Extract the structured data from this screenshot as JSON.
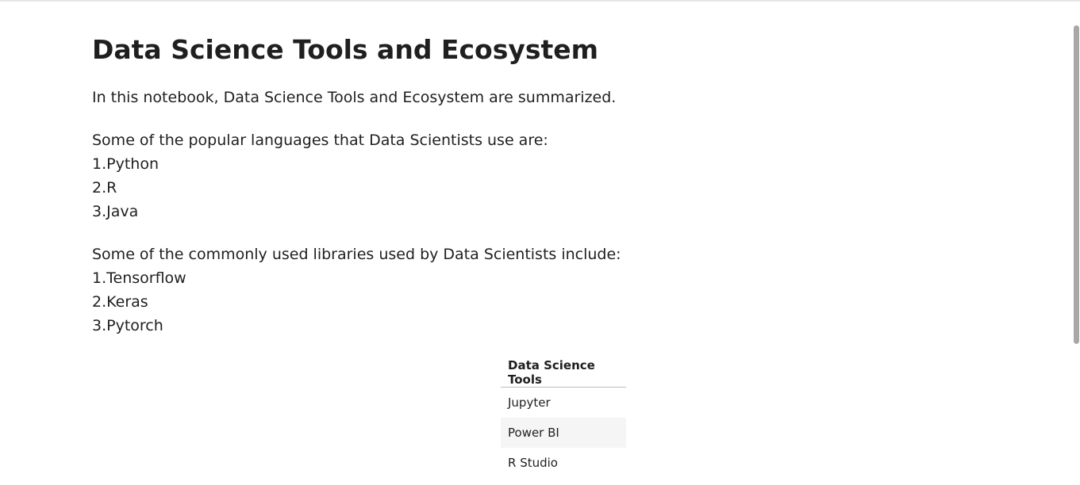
{
  "heading": "Data Science Tools and Ecosystem",
  "intro": "In this notebook, Data Science Tools and Ecosystem are summarized.",
  "languages": {
    "intro": "Some of the popular languages that Data Scientists use are:",
    "items": [
      "1.Python",
      "2.R",
      "3.Java"
    ]
  },
  "libraries": {
    "intro": "Some of the commonly used libraries used by Data Scientists include:",
    "items": [
      "1.Tensorflow",
      "2.Keras",
      "3.Pytorch"
    ]
  },
  "tools_table": {
    "header": "Data Science Tools",
    "rows": [
      "Jupyter",
      "Power BI",
      "R Studio"
    ]
  }
}
